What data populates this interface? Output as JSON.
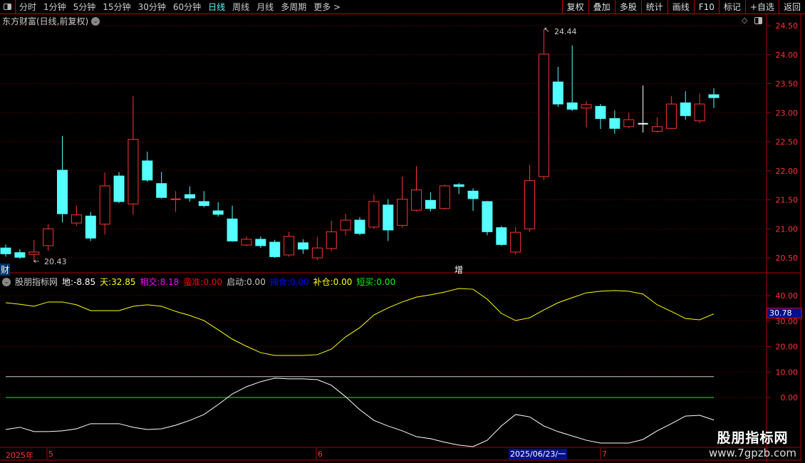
{
  "toolbar": {
    "periods": [
      "分时",
      "1分钟",
      "5分钟",
      "15分钟",
      "30分钟",
      "60分钟",
      "日线",
      "周线",
      "月线",
      "多周期",
      "更多 >"
    ],
    "active_period": "日线",
    "right_buttons": [
      "复权",
      "叠加",
      "多股",
      "统计",
      "画线",
      "F10",
      "标记",
      "+自选",
      "返回"
    ]
  },
  "stock": {
    "title": "东方财富(日线,前复权)"
  },
  "price_axis": {
    "labels": [
      "24.50",
      "24.00",
      "23.50",
      "23.00",
      "22.50",
      "22.00",
      "21.50",
      "21.00",
      "20.50"
    ]
  },
  "annotations": {
    "high_label": "24.44",
    "low_label": "20.43",
    "cai_badge": "财",
    "zeng_badge": "增"
  },
  "indicator": {
    "name": "股朋指标网",
    "values": [
      {
        "label": "地:",
        "value": "-8.85",
        "color": "#ffffff"
      },
      {
        "label": "天:",
        "value": "32.85",
        "color": "#ffff00"
      },
      {
        "label": "相交:",
        "value": "8.18",
        "color": "#ff00ff"
      },
      {
        "label": "蛮准:",
        "value": "0.00",
        "color": "#ff0000"
      },
      {
        "label": "启动:",
        "value": "0.00",
        "color": "#c8c8c8"
      },
      {
        "label": "捕食:",
        "value": "0.00",
        "color": "#0000ff"
      },
      {
        "label": "补仓:",
        "value": "0.00",
        "color": "#ffff00"
      },
      {
        "label": "短买:",
        "value": "0.00",
        "color": "#00ff00"
      }
    ],
    "axis_labels": [
      "40.00",
      "30.00",
      "20.00",
      "10.00",
      "0.00"
    ],
    "current_value": "30.78"
  },
  "date_axis": {
    "labels": [
      "2025年",
      "5",
      "6",
      "7"
    ],
    "cursor_date": "2025/06/23/一"
  },
  "watermark": {
    "name": "股朋指标网",
    "url": "www.7gpzb.com"
  },
  "colors": {
    "up": "#ff3232",
    "down": "#54ffff",
    "grid": "#8b0000",
    "border": "#b00000",
    "yellow": "#ffff00",
    "green": "#00ff00"
  },
  "chart_data": {
    "type": "candlestick",
    "ylim": [
      20.3,
      24.6
    ],
    "candles": [
      [
        20.67,
        20.73,
        20.52,
        20.57
      ],
      [
        20.59,
        20.65,
        20.48,
        20.51
      ],
      [
        20.56,
        20.81,
        20.43,
        20.6
      ],
      [
        20.71,
        21.08,
        20.62,
        21.0
      ],
      [
        22.01,
        22.6,
        21.11,
        21.26
      ],
      [
        21.1,
        21.4,
        21.05,
        21.24
      ],
      [
        21.22,
        21.29,
        20.79,
        20.84
      ],
      [
        21.08,
        21.97,
        20.9,
        21.74
      ],
      [
        21.91,
        21.98,
        21.44,
        21.47
      ],
      [
        21.43,
        23.29,
        21.24,
        22.54
      ],
      [
        22.17,
        22.33,
        21.81,
        21.84
      ],
      [
        21.78,
        21.98,
        21.52,
        21.54
      ],
      [
        21.49,
        21.65,
        21.29,
        21.51
      ],
      [
        21.59,
        21.73,
        21.47,
        21.53
      ],
      [
        21.47,
        21.65,
        21.37,
        21.4
      ],
      [
        21.31,
        21.46,
        21.21,
        21.25
      ],
      [
        21.17,
        21.4,
        20.78,
        20.79
      ],
      [
        20.72,
        20.87,
        20.7,
        20.82
      ],
      [
        20.82,
        20.87,
        20.67,
        20.71
      ],
      [
        20.77,
        20.81,
        20.5,
        20.52
      ],
      [
        20.55,
        20.95,
        20.52,
        20.87
      ],
      [
        20.76,
        20.82,
        20.57,
        20.65
      ],
      [
        20.5,
        20.86,
        20.46,
        20.67
      ],
      [
        20.66,
        21.14,
        20.62,
        20.95
      ],
      [
        20.98,
        21.26,
        20.89,
        21.15
      ],
      [
        21.15,
        21.2,
        20.89,
        20.92
      ],
      [
        21.03,
        21.59,
        21.0,
        21.47
      ],
      [
        21.41,
        21.51,
        20.79,
        20.98
      ],
      [
        21.06,
        21.9,
        21.02,
        21.51
      ],
      [
        21.32,
        22.08,
        21.3,
        21.67
      ],
      [
        21.49,
        21.63,
        21.3,
        21.35
      ],
      [
        21.35,
        21.76,
        21.33,
        21.74
      ],
      [
        21.76,
        21.79,
        21.6,
        21.73
      ],
      [
        21.65,
        21.7,
        21.31,
        21.52
      ],
      [
        21.47,
        21.48,
        20.89,
        20.95
      ],
      [
        21.02,
        21.05,
        20.71,
        20.73
      ],
      [
        20.6,
        21.03,
        20.56,
        20.94
      ],
      [
        21.0,
        22.1,
        20.95,
        21.83
      ],
      [
        21.9,
        24.44,
        21.84,
        24.01
      ],
      [
        23.53,
        23.79,
        23.1,
        23.15
      ],
      [
        23.17,
        24.16,
        23.03,
        23.06
      ],
      [
        23.08,
        23.2,
        22.75,
        23.14
      ],
      [
        23.11,
        23.15,
        22.72,
        22.9
      ],
      [
        22.9,
        23.04,
        22.64,
        22.73
      ],
      [
        22.76,
        23.0,
        22.73,
        22.88
      ],
      [
        22.81,
        23.47,
        22.66,
        22.81
      ],
      [
        22.68,
        22.92,
        22.66,
        22.76
      ],
      [
        22.73,
        23.29,
        22.72,
        23.15
      ],
      [
        23.17,
        23.37,
        22.88,
        22.95
      ],
      [
        22.86,
        23.33,
        22.82,
        23.15
      ],
      [
        23.31,
        23.42,
        23.08,
        23.26
      ]
    ],
    "indicator_ylim": [
      -20,
      47
    ],
    "tian": [
      37.2,
      36.6,
      35.8,
      37.5,
      37.5,
      36.4,
      34.1,
      34.1,
      34.1,
      35.8,
      36.4,
      35.8,
      33.8,
      32.2,
      30.2,
      26.6,
      22.9,
      20.1,
      17.6,
      16.5,
      16.5,
      16.5,
      16.8,
      19.0,
      23.8,
      27.4,
      32.4,
      35.2,
      37.5,
      39.4,
      40.3,
      41.4,
      42.8,
      42.5,
      38.6,
      33.0,
      30.2,
      31.3,
      34.4,
      37.2,
      39.2,
      41.1,
      41.7,
      42.0,
      41.7,
      40.6,
      36.4,
      33.8,
      31.0,
      30.5,
      32.85
    ],
    "di": [
      -12.6,
      -11.7,
      -13.4,
      -13.4,
      -13.1,
      -12.3,
      -10.3,
      -10.3,
      -10.3,
      -11.7,
      -12.6,
      -12.3,
      -10.9,
      -9.0,
      -6.7,
      -2.8,
      1.4,
      4.2,
      6.2,
      7.6,
      7.3,
      7.3,
      7.0,
      4.8,
      0.3,
      -4.8,
      -9.0,
      -11.2,
      -13.1,
      -15.4,
      -16.2,
      -17.6,
      -18.7,
      -19.3,
      -16.8,
      -11.2,
      -6.7,
      -7.6,
      -11.2,
      -13.4,
      -15.1,
      -16.8,
      -17.9,
      -17.9,
      -17.9,
      -16.5,
      -13.1,
      -10.3,
      -7.3,
      -7.0,
      -8.85
    ],
    "xiangjiao": 8.18,
    "zero_line": 0
  }
}
